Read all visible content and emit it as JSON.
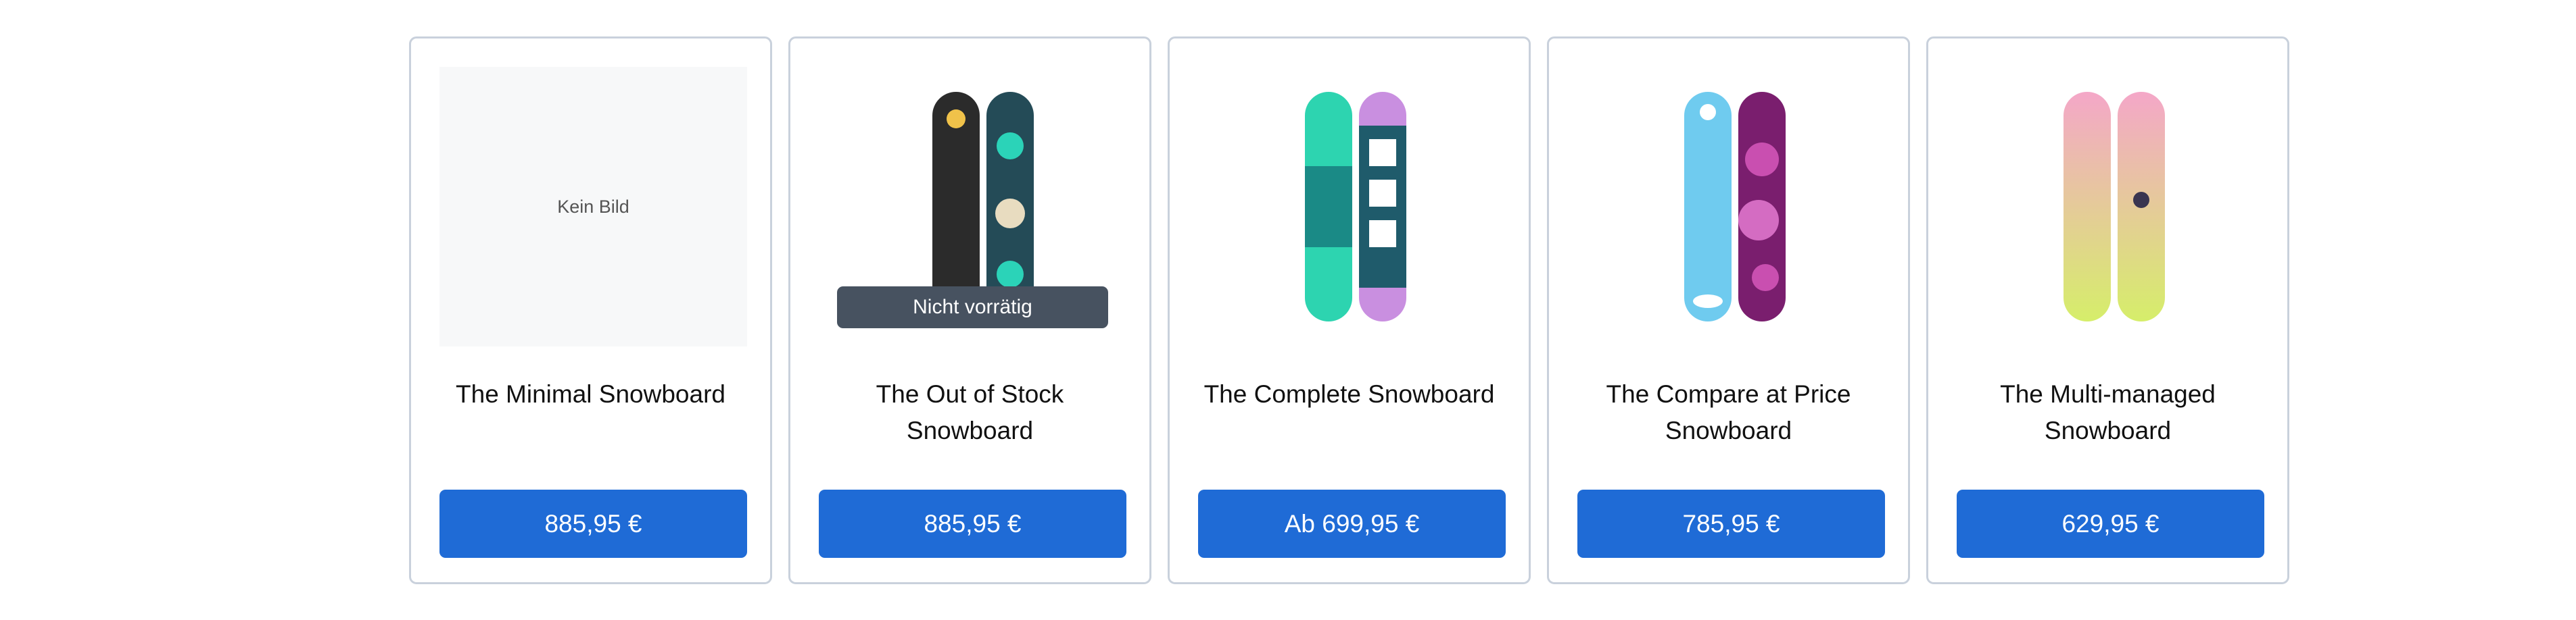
{
  "products": [
    {
      "title": "The Minimal Snowboard",
      "price": "885,95 €",
      "image_placeholder": "Kein Bild"
    },
    {
      "title": "The Out of Stock Snowboard",
      "price": "885,95 €",
      "badge": "Nicht vorrätig"
    },
    {
      "title": "The Complete Snowboard",
      "price": "Ab 699,95 €"
    },
    {
      "title": "The Compare at Price Snowboard",
      "price": "785,95 €"
    },
    {
      "title": "The Multi-managed Snowboard",
      "price": "629,95 €"
    }
  ],
  "colors": {
    "button": "#1f6bd6",
    "badge": "#475260",
    "border": "#c9d1dc"
  }
}
